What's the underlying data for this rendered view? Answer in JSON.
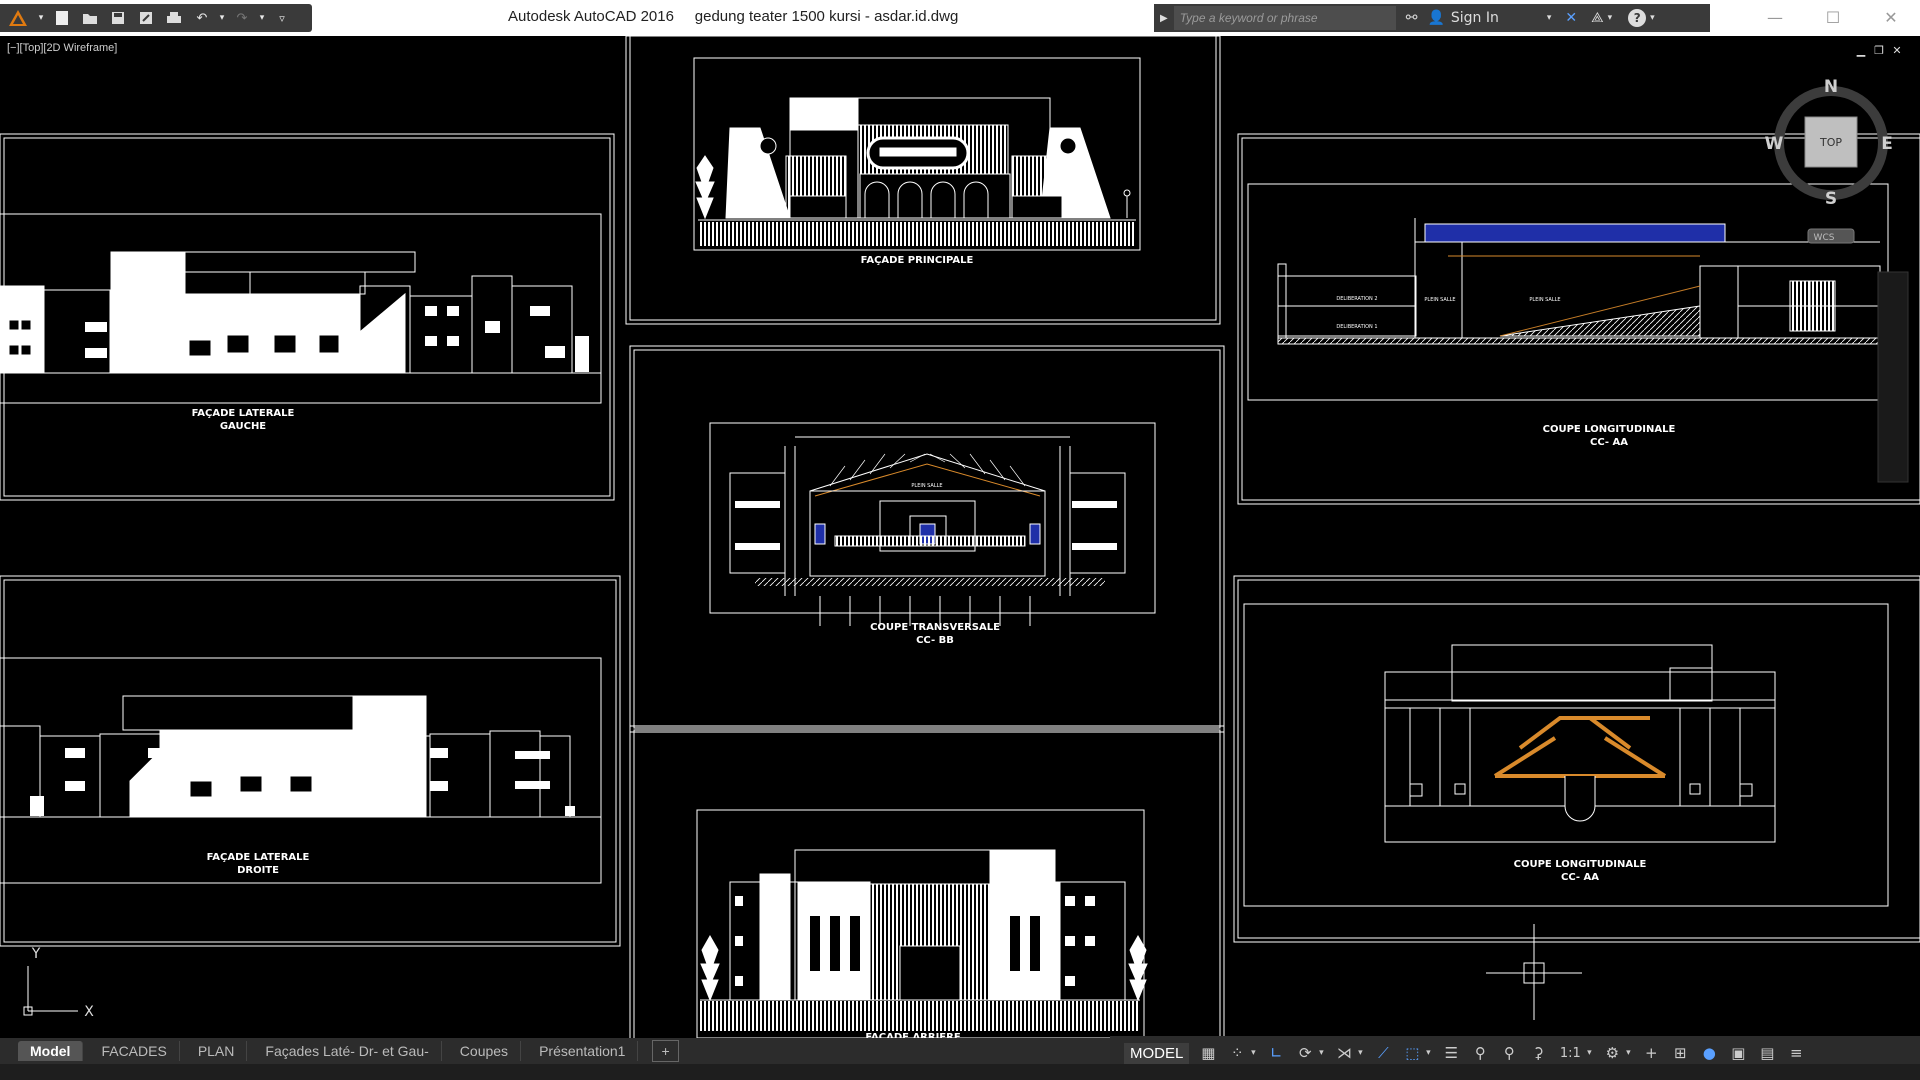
{
  "app": {
    "window_title": "Autodesk AutoCAD 2016     gedung teater 1500 kursi - asdar.id.dwg",
    "search_placeholder": "Type a keyword or phrase",
    "sign_in": "Sign In",
    "help": "?"
  },
  "window_controls": {
    "minimize": "—",
    "maximize": "☐",
    "close": "✕"
  },
  "viewport": {
    "label": "[−][Top][2D Wireframe]",
    "controls": [
      "▁",
      "❐",
      "✕"
    ]
  },
  "viewcube": {
    "north": "N",
    "south": "S",
    "east": "E",
    "west": "W",
    "top": "TOP",
    "wcs": "WCS"
  },
  "ucs": {
    "x": "X",
    "y": "Y"
  },
  "drawings": {
    "lat_gauche": "FAÇADE LATERALE\nGAUCHE",
    "principale": "FAÇADE PRINCIPALE",
    "coupe_long_1": "COUPE LONGITUDINALE\nCC- AA",
    "coupe_trans": "COUPE TRANSVERSALE\nCC- BB",
    "lat_droite": "FAÇADE LATERALE\nDROITE",
    "coupe_long_2": "COUPE LONGITUDINALE\nCC- AA",
    "arriere": "FAÇADE ARRIERE",
    "section_room_labels": [
      "DELIBERATION 2",
      "DELIBERATION 1",
      "PLEIN SALLE",
      "PLEIN SALLE"
    ],
    "trans_room_label": "PLEIN SALLE"
  },
  "tabs": [
    "Model",
    "FACADES",
    "PLAN",
    "Façades Laté- Dr- et Gau-",
    "Coupes",
    "Présentation1"
  ],
  "tabs_add": "+",
  "status": {
    "model": "MODEL",
    "scale": "1:1"
  },
  "colors": {
    "background": "#000000",
    "linework": "#ffffff",
    "accent_blue": "#1f2fa8",
    "accent_orange": "#d98a2b"
  }
}
